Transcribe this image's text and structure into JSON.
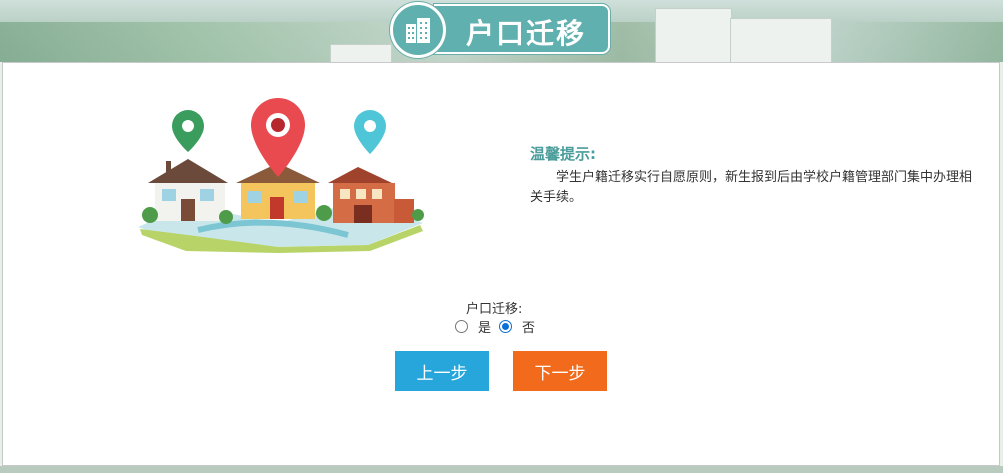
{
  "header": {
    "title": "户口迁移",
    "icon": "building-icon"
  },
  "tips": {
    "title": "温馨提示:",
    "body": "学生户籍迁移实行自愿原则，新生报到后由学校户籍管理部门集中办理相关手续。"
  },
  "form": {
    "label": "户口迁移:",
    "options": [
      {
        "label": "是",
        "selected": false
      },
      {
        "label": "否",
        "selected": true
      }
    ]
  },
  "buttons": {
    "prev": "上一步",
    "next": "下一步"
  },
  "colors": {
    "accent": "#5fb0ae",
    "prev_button": "#27a6db",
    "next_button": "#f26b1d",
    "tips_title": "#4b9d9b"
  }
}
